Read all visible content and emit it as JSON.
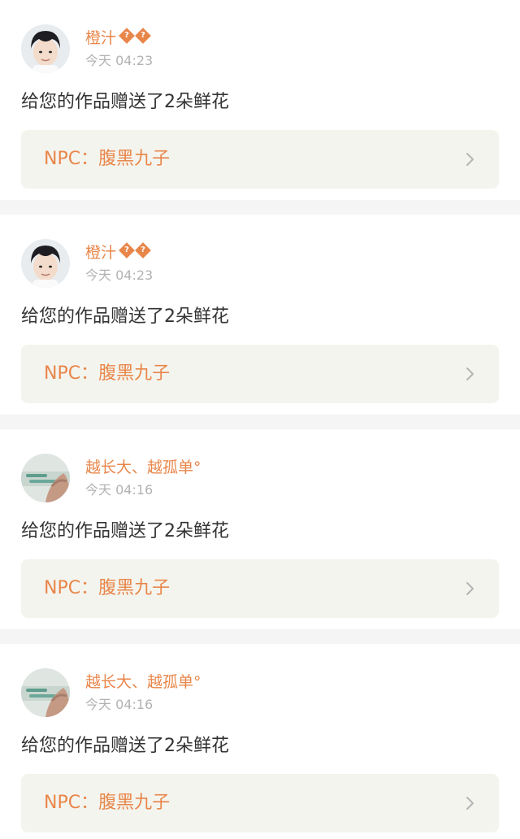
{
  "colors": {
    "accent": "#e8864a",
    "muted": "#b2b2b2",
    "text": "#333333",
    "link_bg": "#f4f4ee",
    "divider": "#f5f5f5"
  },
  "notifications": [
    {
      "username": "橙汁",
      "badges": [
        "?",
        "?"
      ],
      "timestamp": "今天 04:23",
      "message": "给您的作品赠送了2朵鲜花",
      "work_title": "NPC：腹黑九子",
      "avatar": "photo-avatar-boy-icon",
      "chevron_icon": "chevron-right-icon"
    },
    {
      "username": "橙汁",
      "badges": [
        "?",
        "?"
      ],
      "timestamp": "今天 04:23",
      "message": "给您的作品赠送了2朵鲜花",
      "work_title": "NPC：腹黑九子",
      "avatar": "photo-avatar-boy-icon",
      "chevron_icon": "chevron-right-icon"
    },
    {
      "username": "越长大、越孤单°",
      "badges": [],
      "timestamp": "今天 04:16",
      "message": "给您的作品赠送了2朵鲜花",
      "work_title": "NPC：腹黑九子",
      "avatar": "photo-avatar-hand-icon",
      "chevron_icon": "chevron-right-icon"
    },
    {
      "username": "越长大、越孤单°",
      "badges": [],
      "timestamp": "今天 04:16",
      "message": "给您的作品赠送了2朵鲜花",
      "work_title": "NPC：腹黑九子",
      "avatar": "photo-avatar-hand-icon",
      "chevron_icon": "chevron-right-icon"
    }
  ]
}
